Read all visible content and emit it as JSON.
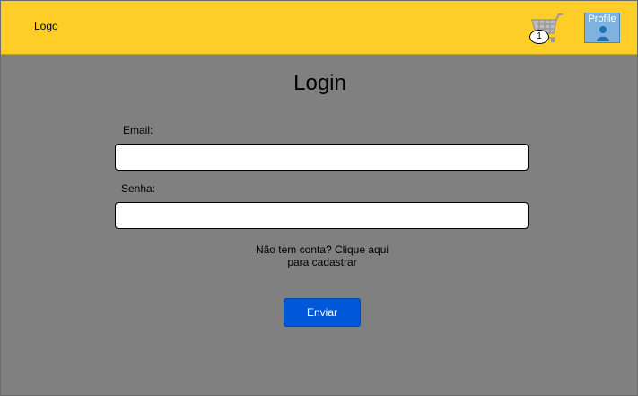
{
  "header": {
    "logo_text": "Logo",
    "cart": {
      "icon": "shopping-cart-icon",
      "badge_count": "1"
    },
    "profile": {
      "label": "Profile",
      "icon": "user-avatar-icon"
    }
  },
  "form": {
    "title": "Login",
    "email": {
      "label": "Email:",
      "value": "",
      "placeholder": ""
    },
    "password": {
      "label": "Senha:",
      "value": "",
      "placeholder": ""
    },
    "signup_line1": "Não tem conta? Clique aqui",
    "signup_line2": "para cadastrar",
    "submit_label": "Enviar"
  },
  "colors": {
    "header_bg": "#ffcd28",
    "page_bg": "#808080",
    "button_bg": "#0057d8",
    "profile_bg": "#7fb2de"
  }
}
